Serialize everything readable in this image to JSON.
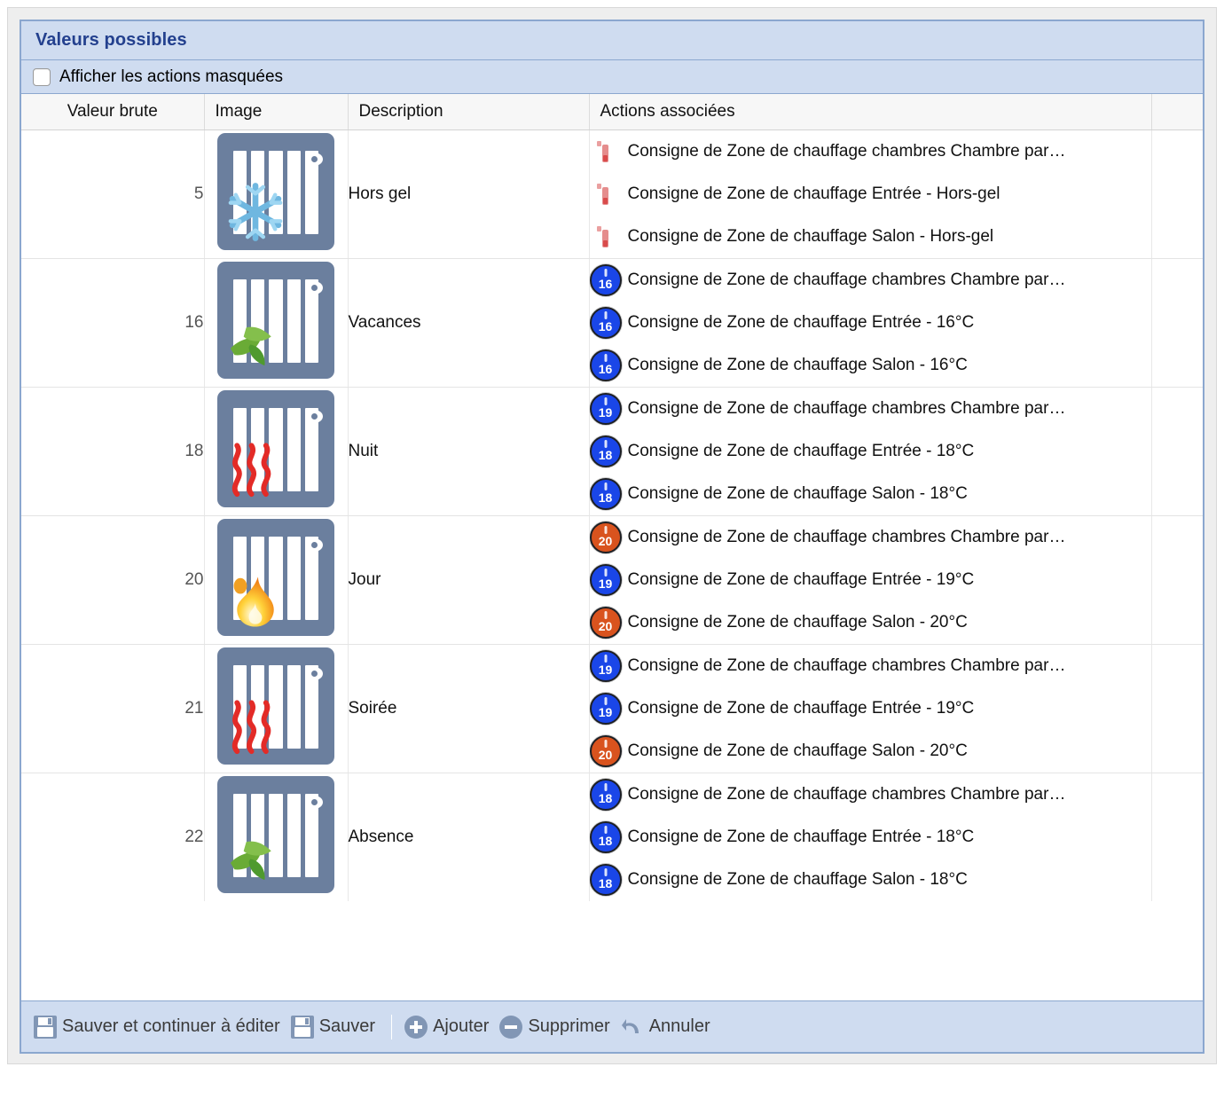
{
  "panel": {
    "title": "Valeurs possibles",
    "show_hidden_label": "Afficher les actions masquées",
    "show_hidden_checked": false
  },
  "colors": {
    "panel_border": "#8ba7cf",
    "header_band": "#cfdcf0",
    "title_text": "#23408e",
    "radiator_bg": "#6b7f9e",
    "badge_blue": "#1a46e8",
    "badge_orange": "#d9531e",
    "frost_icon": "#e06a6a",
    "toolbar_icon": "#8196b5"
  },
  "table": {
    "columns": [
      "Valeur brute",
      "Image",
      "Description",
      "Actions associées",
      ""
    ],
    "rows": [
      {
        "value": "5",
        "icon": "radiator-snowflake-icon",
        "description": "Hors gel",
        "actions": [
          {
            "badge_kind": "frost",
            "badge_text": "",
            "label": "Consigne de Zone de chauffage chambres Chambre par…"
          },
          {
            "badge_kind": "frost",
            "badge_text": "",
            "label": "Consigne de Zone de chauffage Entrée - Hors-gel"
          },
          {
            "badge_kind": "frost",
            "badge_text": "",
            "label": "Consigne de Zone de chauffage Salon - Hors-gel"
          }
        ]
      },
      {
        "value": "16",
        "icon": "radiator-leaf-icon",
        "description": "Vacances",
        "actions": [
          {
            "badge_kind": "blue",
            "badge_text": "16",
            "label": "Consigne de Zone de chauffage chambres Chambre par…"
          },
          {
            "badge_kind": "blue",
            "badge_text": "16",
            "label": "Consigne de Zone de chauffage Entrée - 16°C"
          },
          {
            "badge_kind": "blue",
            "badge_text": "16",
            "label": "Consigne de Zone de chauffage Salon - 16°C"
          }
        ]
      },
      {
        "value": "18",
        "icon": "radiator-heatwaves-icon",
        "description": "Nuit",
        "actions": [
          {
            "badge_kind": "blue",
            "badge_text": "19",
            "label": "Consigne de Zone de chauffage chambres Chambre par…"
          },
          {
            "badge_kind": "blue",
            "badge_text": "18",
            "label": "Consigne de Zone de chauffage Entrée - 18°C"
          },
          {
            "badge_kind": "blue",
            "badge_text": "18",
            "label": "Consigne de Zone de chauffage Salon - 18°C"
          }
        ]
      },
      {
        "value": "20",
        "icon": "radiator-flame-icon",
        "description": "Jour",
        "actions": [
          {
            "badge_kind": "orange",
            "badge_text": "20",
            "label": "Consigne de Zone de chauffage chambres Chambre par…"
          },
          {
            "badge_kind": "blue",
            "badge_text": "19",
            "label": "Consigne de Zone de chauffage Entrée - 19°C"
          },
          {
            "badge_kind": "orange",
            "badge_text": "20",
            "label": "Consigne de Zone de chauffage Salon - 20°C"
          }
        ]
      },
      {
        "value": "21",
        "icon": "radiator-heatwaves-icon",
        "description": "Soirée",
        "actions": [
          {
            "badge_kind": "blue",
            "badge_text": "19",
            "label": "Consigne de Zone de chauffage chambres Chambre par…"
          },
          {
            "badge_kind": "blue",
            "badge_text": "19",
            "label": "Consigne de Zone de chauffage Entrée - 19°C"
          },
          {
            "badge_kind": "orange",
            "badge_text": "20",
            "label": "Consigne de Zone de chauffage Salon - 20°C"
          }
        ]
      },
      {
        "value": "22",
        "icon": "radiator-leaf-icon",
        "description": "Absence",
        "actions": [
          {
            "badge_kind": "blue",
            "badge_text": "18",
            "label": "Consigne de Zone de chauffage chambres Chambre par…"
          },
          {
            "badge_kind": "blue",
            "badge_text": "18",
            "label": "Consigne de Zone de chauffage Entrée - 18°C"
          },
          {
            "badge_kind": "blue",
            "badge_text": "18",
            "label": "Consigne de Zone de chauffage Salon - 18°C"
          }
        ]
      }
    ]
  },
  "toolbar": {
    "buttons": [
      {
        "label": "Sauver et continuer à éditer",
        "icon": "floppy-icon"
      },
      {
        "label": "Sauver",
        "icon": "floppy-icon"
      },
      {
        "label": "Ajouter",
        "icon": "plus-circle-icon"
      },
      {
        "label": "Supprimer",
        "icon": "minus-circle-icon"
      },
      {
        "label": "Annuler",
        "icon": "undo-icon"
      }
    ]
  }
}
